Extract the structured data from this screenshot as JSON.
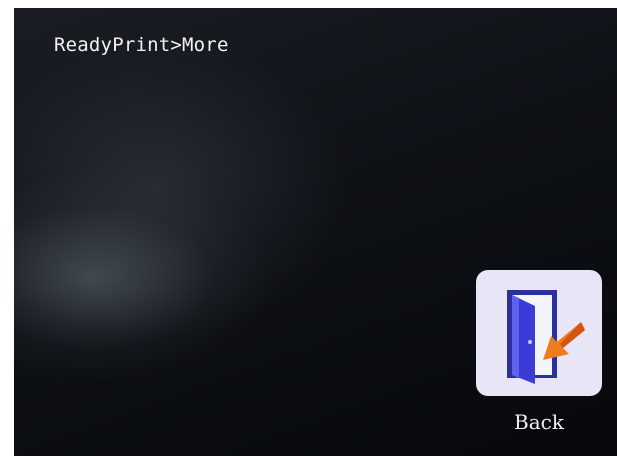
{
  "header": {
    "breadcrumb": "ReadyPrint>More"
  },
  "actions": {
    "back": {
      "label": "Back",
      "icon": "door-exit-icon"
    }
  },
  "colors": {
    "screen_background": "#0e1116",
    "text": "#f2f2f2",
    "tile_background": "#e7e5f6",
    "door_blue": "#3b3bd6",
    "arrow_orange": "#f07a1e"
  }
}
